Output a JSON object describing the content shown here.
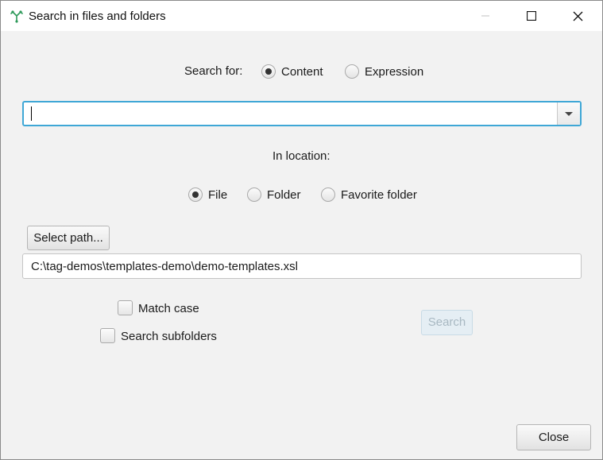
{
  "window": {
    "title": "Search in files and folders",
    "icon": "tag-tree-icon",
    "controls": [
      "minimize-icon",
      "maximize-icon",
      "close-icon"
    ]
  },
  "search_for": {
    "label": "Search for:",
    "options": [
      {
        "label": "Content",
        "selected": true
      },
      {
        "label": "Expression",
        "selected": false
      }
    ],
    "query_value": ""
  },
  "location": {
    "label": "In location:",
    "options": [
      {
        "label": "File",
        "selected": true
      },
      {
        "label": "Folder",
        "selected": false
      },
      {
        "label": "Favorite folder",
        "selected": false
      }
    ],
    "select_path_label": "Select path...",
    "path_value": "C:\\tag-demos\\templates-demo\\demo-templates.xsl"
  },
  "options": {
    "match_case_label": "Match case",
    "match_case_checked": false,
    "search_subfolders_label": "Search subfolders",
    "search_subfolders_checked": false
  },
  "actions": {
    "search_label": "Search",
    "search_enabled": false,
    "close_label": "Close"
  },
  "colors": {
    "focus_border": "#3fa7d6",
    "app_icon": "#2e9a5a"
  }
}
